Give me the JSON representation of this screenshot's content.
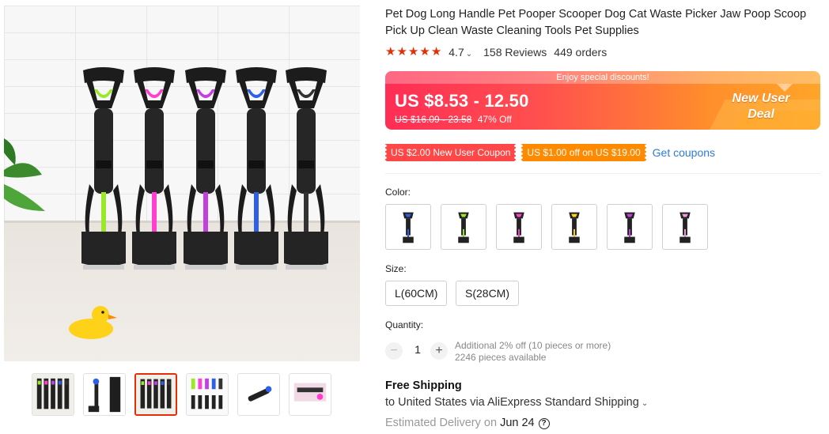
{
  "product": {
    "title": "Pet Dog Long Handle Pet Pooper Scooper Dog Cat Waste Picker Jaw Poop Scoop Pick Up Clean Waste Cleaning Tools Pet Supplies"
  },
  "rating": {
    "stars": 5,
    "value": "4.7",
    "reviews": "158 Reviews",
    "orders": "449 orders",
    "star_color": "#e62e04"
  },
  "price": {
    "banner_top": "Enjoy special discounts!",
    "current": "US $8.53 - 12.50",
    "original": "US $16.09 - 23.58",
    "discount": "47% Off",
    "deal_line1": "New User",
    "deal_line2": "Deal"
  },
  "coupons": {
    "new_user": "US $2.00 New User Coupon",
    "store": "US $1.00 off on US $19.00",
    "get_link": "Get coupons"
  },
  "color": {
    "label": "Color:",
    "options": [
      {
        "name": "blue"
      },
      {
        "name": "green"
      },
      {
        "name": "pink"
      },
      {
        "name": "yellow"
      },
      {
        "name": "purple"
      },
      {
        "name": "light-pink"
      }
    ]
  },
  "size": {
    "label": "Size:",
    "options": [
      "L(60CM)",
      "S(28CM)"
    ]
  },
  "quantity": {
    "label": "Quantity:",
    "minus": "−",
    "plus": "+",
    "value": "1",
    "note_line1": "Additional 2% off (10 pieces or more)",
    "note_line2": "2246 pieces available"
  },
  "shipping": {
    "title": "Free Shipping",
    "to": "to United States via AliExpress Standard Shipping",
    "estimated_label": "Estimated Delivery on",
    "estimated_date": "Jun 24",
    "help": "?"
  },
  "gallery": {
    "tool_colors": [
      "#9be82a",
      "#ff3fcf",
      "#c43fe0",
      "#2f5fe6",
      "#333333"
    ],
    "thumbnails": 6,
    "active_thumbnail": 2
  },
  "colors": {
    "accent": "#e62e04",
    "link": "#2e7bd6",
    "coupon_red": "#ff4747",
    "coupon_orange": "#ff8a00"
  }
}
